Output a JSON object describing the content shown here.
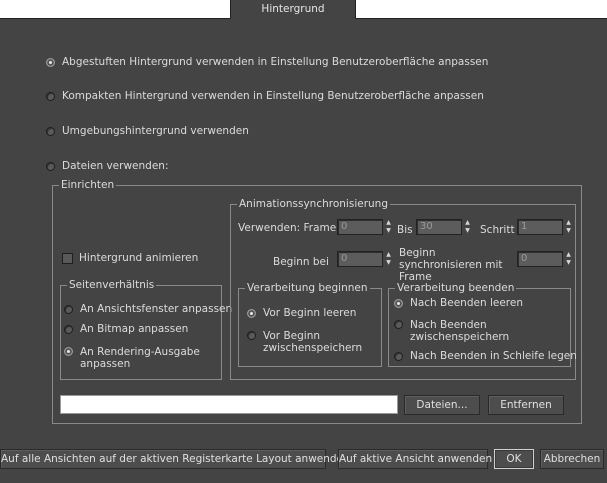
{
  "tab": {
    "label": "Hintergrund"
  },
  "background_options": [
    {
      "label": "Abgestuften Hintergrund verwenden in Einstellung Benutzeroberfläche anpassen",
      "selected": true
    },
    {
      "label": "Kompakten Hintergrund verwenden in Einstellung Benutzeroberfläche anpassen",
      "selected": false
    },
    {
      "label": "Umgebungshintergrund verwenden",
      "selected": false
    },
    {
      "label": "Dateien verwenden:",
      "selected": false
    }
  ],
  "setup": {
    "legend": "Einrichten",
    "animate_checkbox": {
      "label": "Hintergrund animieren",
      "checked": false
    },
    "aspect": {
      "legend": "Seitenverhältnis",
      "options": [
        {
          "label": "An Ansichtsfenster anpassen",
          "selected": false
        },
        {
          "label": "An Bitmap anpassen",
          "selected": false
        },
        {
          "label": "An Rendering-Ausgabe anpassen",
          "selected": true
        }
      ]
    },
    "anim_sync": {
      "legend": "Animationssynchronisierung",
      "use_frame_label": "Verwenden: Frame",
      "use_frame_value": "0",
      "to_label": "Bis",
      "to_value": "30",
      "step_label": "Schritt",
      "step_value": "1",
      "start_at_label": "Beginn bei",
      "start_at_value": "0",
      "sync_start_label": "Beginn synchronisieren mit Frame",
      "sync_start_value": "0",
      "start_processing": {
        "legend": "Verarbeitung beginnen",
        "options": [
          {
            "label": "Vor Beginn leeren",
            "selected": true
          },
          {
            "label": "Vor Beginn zwischenspeichern",
            "selected": false
          }
        ]
      },
      "end_processing": {
        "legend": "Verarbeitung beenden",
        "options": [
          {
            "label": "Nach Beenden leeren",
            "selected": true
          },
          {
            "label": "Nach Beenden zwischenspeichern",
            "selected": false
          },
          {
            "label": "Nach Beenden in Schleife legen",
            "selected": false
          }
        ]
      }
    },
    "file_path_value": "",
    "files_button": "Dateien...",
    "remove_button": "Entfernen"
  },
  "footer": {
    "apply_all_button": "Auf alle Ansichten auf der aktiven Registerkarte Layout anwenden",
    "apply_active_button": "Auf aktive Ansicht anwenden",
    "ok_button": "OK",
    "cancel_button": "Abbrechen"
  }
}
